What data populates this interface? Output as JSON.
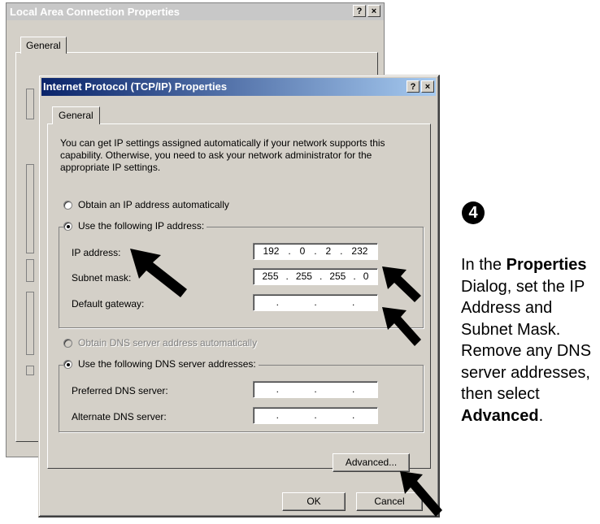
{
  "back_window": {
    "title": "Local Area Connection Properties",
    "help_label": "?",
    "close_label": "×",
    "tab_general": "General"
  },
  "dialog": {
    "title": "Internet Protocol (TCP/IP) Properties",
    "help_label": "?",
    "close_label": "×",
    "tab_general": "General",
    "description": "You can get IP settings assigned automatically if your network supports this capability. Otherwise, you need to ask your network administrator for the appropriate IP settings.",
    "ip_auto_label": "Obtain an IP address automatically",
    "ip_manual_label": "Use the following IP address:",
    "ip_address_label": "IP address:",
    "ip_address_value": [
      "192",
      "0",
      "2",
      "232"
    ],
    "subnet_label": "Subnet mask:",
    "subnet_value": [
      "255",
      "255",
      "255",
      "0"
    ],
    "gateway_label": "Default gateway:",
    "dns_auto_label": "Obtain DNS server address automatically",
    "dns_manual_label": "Use the following DNS server addresses:",
    "preferred_dns_label": "Preferred DNS server:",
    "alternate_dns_label": "Alternate DNS server:",
    "advanced_button": "Advanced...",
    "ok_button": "OK",
    "cancel_button": "Cancel"
  },
  "instructions": {
    "step_number": "4",
    "text_1": "In the ",
    "bold_1": "Properties",
    "text_2": " Dialog, set the IP Address and Subnet Mask. Remove any DNS server addresses, then select ",
    "bold_2": "Advanced",
    "text_3": "."
  }
}
